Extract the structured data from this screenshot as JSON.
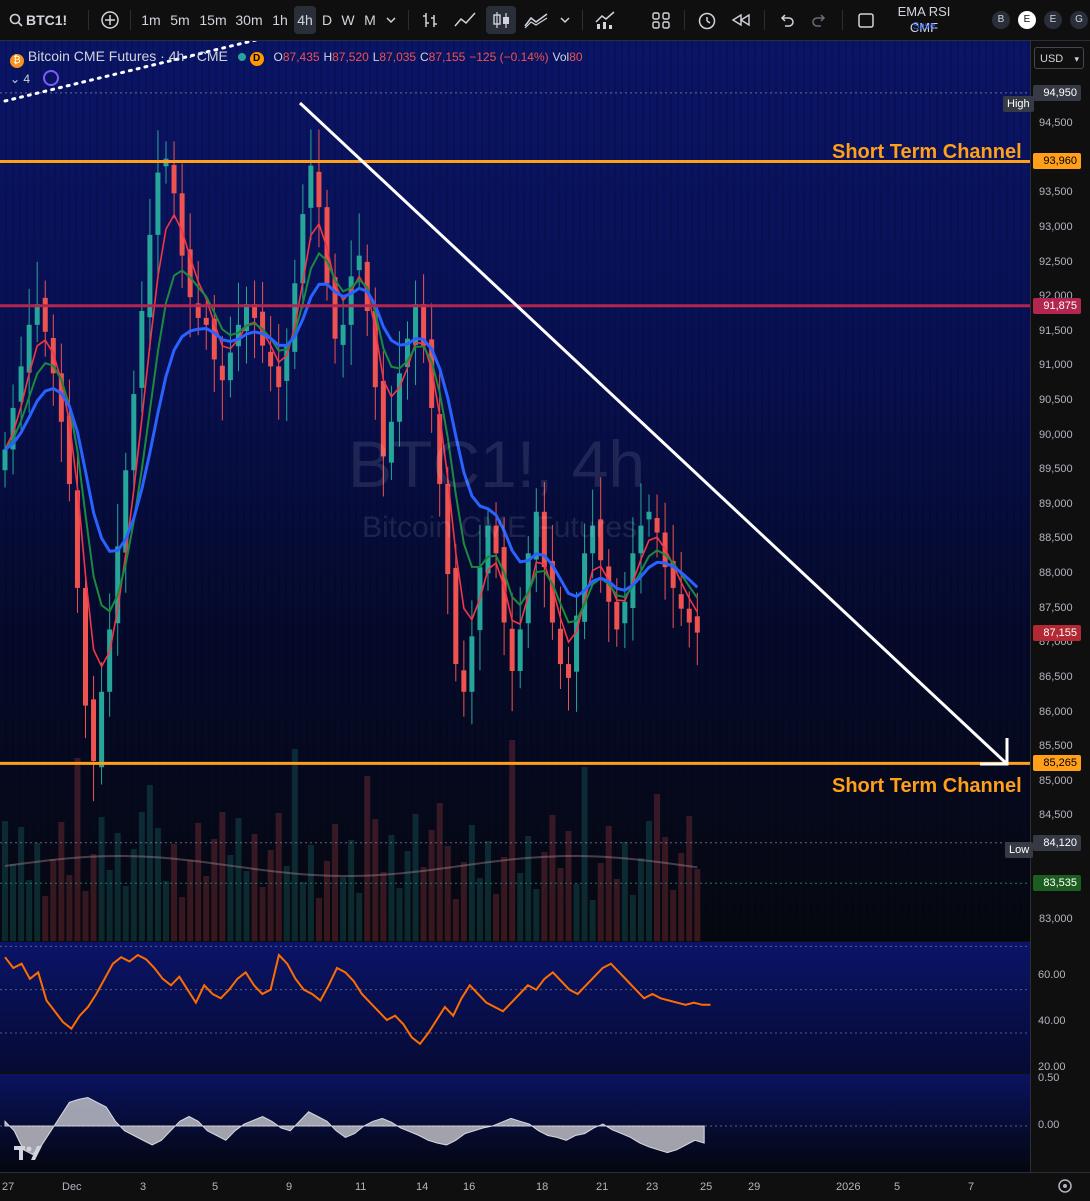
{
  "toolbar": {
    "symbol": "BTC1!",
    "intervals": [
      "1m",
      "5m",
      "15m",
      "30m",
      "1h",
      "4h",
      "D",
      "W",
      "M"
    ],
    "selected_interval": "4h",
    "layout_name": "EMA RSI CMF",
    "layout_save": "Save",
    "profile_letters": [
      "B",
      "E",
      "E",
      "G"
    ]
  },
  "legend": {
    "title": "Bitcoin CME Futures · 4h · CME",
    "badge": "D",
    "open_label": "O",
    "open": "87,435",
    "high_label": "H",
    "high": "87,520",
    "low_label": "L",
    "low": "87,035",
    "close_label": "C",
    "close": "87,155",
    "change": "−125 (−0.14%)",
    "vol_label": "Vol",
    "vol": "80",
    "indicator_count": "4"
  },
  "watermark": {
    "symbol": "BTC1!, 4h",
    "name": "Bitcoin CME Futures"
  },
  "annotations": {
    "channel_top": "Short Term Channel",
    "channel_bottom": "Short Term Channel"
  },
  "price_axis": {
    "currency": "USD",
    "ticks": [
      "94,500",
      "93,500",
      "93,000",
      "92,500",
      "92,000",
      "91,500",
      "91,000",
      "90,500",
      "90,000",
      "89,500",
      "89,000",
      "88,500",
      "88,000",
      "87,500",
      "87,000",
      "86,500",
      "86,000",
      "85,500",
      "85,000",
      "84,500",
      "83,000"
    ],
    "high_label": "High",
    "high_value": "94,950",
    "low_label": "Low",
    "low_value": "84,120",
    "level_top": "93,960",
    "level_mid": "91,875",
    "level_bottom": "85,265",
    "last_price": "87,155",
    "ema_value": "83,535"
  },
  "rsi_axis": {
    "ticks": [
      "60.00",
      "40.00",
      "20.00"
    ]
  },
  "cmf_axis": {
    "ticks": [
      "0.50",
      "0.00"
    ]
  },
  "time_axis": {
    "labels": [
      "27",
      "Dec",
      "3",
      "5",
      "9",
      "11",
      "14",
      "16",
      "18",
      "21",
      "23",
      "25",
      "29",
      "2026",
      "5",
      "7"
    ]
  },
  "colors": {
    "bull": "#26a69a",
    "bear": "#ef5350",
    "ema_blue": "#2962ff",
    "ema_red": "#f23645",
    "ema_green": "#1b8a3e",
    "channel": "#ff9f1a",
    "mid_level": "#b3264f",
    "rsi": "#ff6d00",
    "trend": "#ffffff"
  },
  "chart_data": {
    "type": "candlestick",
    "ylim": [
      82700,
      95700
    ],
    "levels": {
      "resistance": 93960,
      "mid": 91875,
      "support": 85265,
      "high": 94950,
      "low": 84120
    },
    "close_series": [
      89800,
      90400,
      91000,
      91600,
      91900,
      91500,
      90900,
      90200,
      89300,
      87800,
      86100,
      85300,
      86300,
      87200,
      88400,
      89500,
      90600,
      91800,
      92900,
      93800,
      94000,
      93500,
      92600,
      92000,
      91700,
      91600,
      91100,
      90800,
      91200,
      91600,
      91900,
      91700,
      91300,
      91000,
      90700,
      91300,
      92200,
      93200,
      93900,
      93300,
      92200,
      91400,
      91600,
      92300,
      92600,
      91800,
      90700,
      89700,
      90200,
      90900,
      91400,
      91900,
      91300,
      90400,
      89300,
      88000,
      86700,
      86300,
      87100,
      88100,
      88700,
      88300,
      87300,
      86600,
      87200,
      88300,
      88900,
      88100,
      87300,
      86700,
      86500,
      87400,
      88300,
      88700,
      88200,
      87600,
      87200,
      87600,
      88300,
      88700,
      88900,
      88600,
      88100,
      87800,
      87500,
      87300,
      87155
    ],
    "rsi": [
      65,
      60,
      62,
      55,
      58,
      45,
      40,
      35,
      32,
      38,
      42,
      48,
      55,
      62,
      65,
      63,
      66,
      64,
      60,
      55,
      52,
      56,
      50,
      44,
      52,
      48,
      46,
      50,
      55,
      58,
      52,
      48,
      50,
      66,
      62,
      55,
      50,
      48,
      45,
      52,
      60,
      58,
      54,
      48,
      44,
      40,
      36,
      38,
      34,
      28,
      25,
      30,
      36,
      42,
      38,
      46,
      52,
      48,
      44,
      42,
      40,
      44,
      48,
      52,
      50,
      55,
      58,
      54,
      50,
      48,
      52,
      56,
      60,
      62,
      58,
      54,
      50,
      46,
      48,
      46,
      45,
      44,
      43,
      44,
      43,
      43
    ],
    "cmf": [
      0.05,
      -0.05,
      -0.25,
      -0.3,
      -0.2,
      -0.05,
      0.1,
      0.25,
      0.28,
      0.3,
      0.25,
      0.2,
      0.05,
      -0.05,
      -0.1,
      -0.15,
      -0.2,
      -0.15,
      -0.05,
      0.05,
      0.1,
      0.05,
      -0.05,
      -0.1,
      -0.15,
      -0.05,
      0.02,
      0.06,
      0.1,
      0.05,
      -0.02,
      -0.05,
      0.05,
      0.15,
      0.1,
      0.05,
      -0.05,
      -0.12,
      -0.08,
      0.0,
      0.05,
      0.08,
      0.04,
      -0.02,
      -0.06,
      -0.1,
      -0.15,
      -0.18,
      -0.2,
      -0.15,
      -0.08,
      -0.05,
      -0.02,
      0.0,
      0.04,
      0.08,
      0.05,
      0.02,
      -0.05,
      -0.1,
      -0.12,
      -0.15,
      -0.1,
      -0.08,
      -0.02,
      0.02,
      -0.04,
      -0.08,
      -0.12,
      -0.18,
      -0.22,
      -0.25,
      -0.28,
      -0.25,
      -0.2,
      -0.15,
      -0.18
    ]
  }
}
